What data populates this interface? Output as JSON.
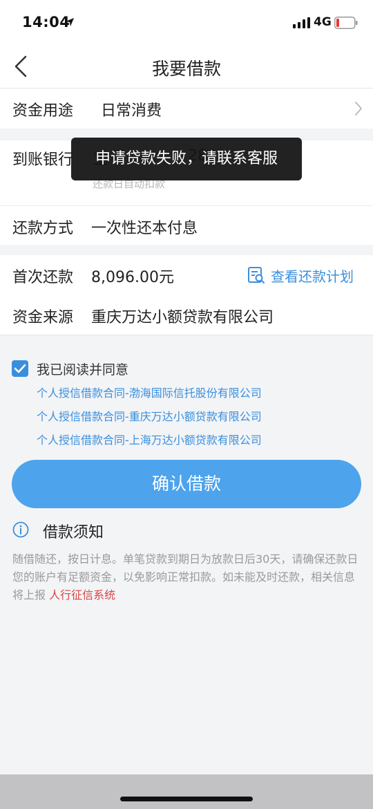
{
  "status_bar": {
    "time": "14:04",
    "network": "4G"
  },
  "nav": {
    "title": "我要借款"
  },
  "purpose": {
    "label": "资金用途",
    "value": "日常消费"
  },
  "bank": {
    "label": "到账银行",
    "value": "工",
    "value_partial": "28",
    "sub": "还款日自动扣款"
  },
  "method": {
    "label": "还款方式",
    "value": "一次性还本付息"
  },
  "repayment": {
    "first_label": "首次还款",
    "first_value": "8,096.00元",
    "plan_link": "查看还款计划",
    "source_label": "资金来源",
    "source_value": "重庆万达小额贷款有限公司"
  },
  "agreement": {
    "checked": true,
    "label": "我已阅读并同意",
    "contracts": [
      "个人授信借款合同-渤海国际信托股份有限公司",
      "个人授信借款合同-重庆万达小额贷款有限公司",
      "个人授信借款合同-上海万达小额贷款有限公司"
    ]
  },
  "confirm_button": "确认借款",
  "notice": {
    "title": "借款须知",
    "text": "随借随还，按日计息。单笔贷款到期日为放款日后30天，请确保还款日您的账户有足额资金，以免影响正常扣款。如未能及时还款，相关信息将上报 ",
    "highlight": "人行征信系统"
  },
  "toast": "申请贷款失败，请联系客服",
  "colors": {
    "accent": "#3a8fdd",
    "button": "#4da3ec",
    "warning": "#d64545",
    "battery_low": "#e53935"
  }
}
